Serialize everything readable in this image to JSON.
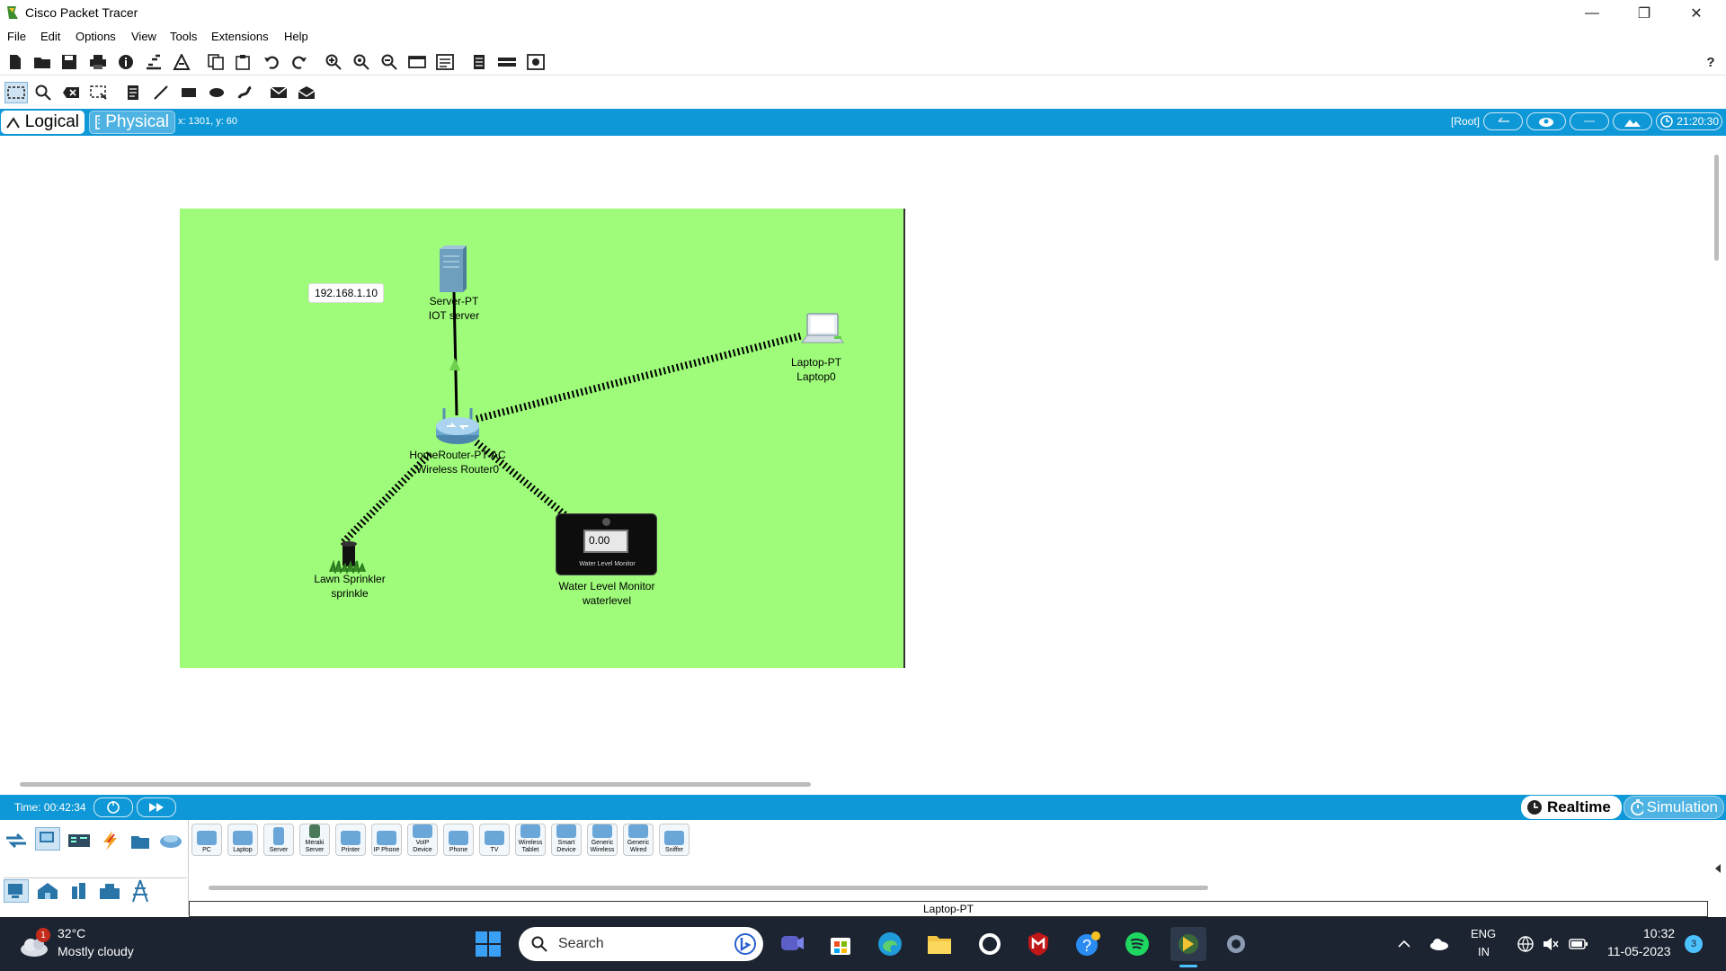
{
  "window": {
    "title": "Cisco Packet Tracer",
    "minimize": "—",
    "maximize": "❐",
    "close": "✕"
  },
  "menu": [
    "File",
    "Edit",
    "Options",
    "View",
    "Tools",
    "Extensions",
    "Help"
  ],
  "toolbar_main": {
    "help_label": "?"
  },
  "tabs": {
    "logical": "Logical",
    "physical": "Physical",
    "coords": "x: 1301, y: 60"
  },
  "status": {
    "root": "[Root]",
    "clock": "21:20:30"
  },
  "workspace": {
    "ip_label": "192.168.1.10",
    "devices": {
      "server": {
        "model": "Server-PT",
        "name": "IOT server"
      },
      "laptop": {
        "model": "Laptop-PT",
        "name": "Laptop0"
      },
      "router": {
        "model": "HomeRouter-PT-AC",
        "name": "Wireless Router0"
      },
      "sprinkler": {
        "model": "Lawn Sprinkler",
        "name": "sprinkle"
      },
      "waterlevel": {
        "model": "Water Level Monitor",
        "name": "waterlevel",
        "display_value": "0.00",
        "caption": "Water Level Monitor"
      }
    }
  },
  "timebar": {
    "time": "Time: 00:42:34",
    "realtime": "Realtime",
    "simulation": "Simulation"
  },
  "device_tiles": [
    "PC",
    "Laptop",
    "Server",
    "Meraki Server",
    "Printer",
    "IP Phone",
    "VoIP Device",
    "Phone",
    "TV",
    "Wireless Tablet",
    "Smart Device",
    "Generic Wireless",
    "Generic Wired",
    "Sniffer"
  ],
  "selected_device": "Laptop-PT",
  "taskbar": {
    "weather_temp": "32°C",
    "weather_desc": "Mostly cloudy",
    "weather_badge": "1",
    "search_placeholder": "Search",
    "lang": "ENG",
    "region": "IN",
    "time": "10:32",
    "date": "11-05-2023",
    "notif_count": "3"
  }
}
